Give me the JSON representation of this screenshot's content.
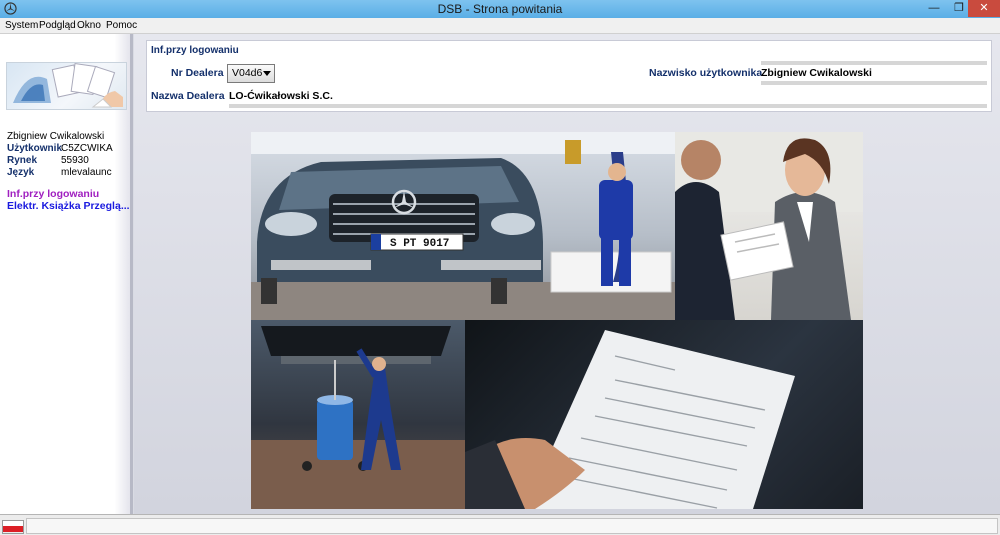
{
  "window": {
    "title": "DSB - Strona powitania",
    "min_glyph": "—",
    "max_glyph": "❐",
    "close_glyph": "✕"
  },
  "menu": {
    "items": [
      "System",
      "Podgląd",
      "Okno",
      "Pomoc"
    ]
  },
  "sidebar": {
    "user_name": "Zbigniew Cwikalowski",
    "rows": [
      {
        "label": "Użytkownik",
        "value": "C5ZCWIKA"
      },
      {
        "label": "Rynek",
        "value": "55930"
      },
      {
        "label": "Język",
        "value": "mlevalaunc"
      }
    ],
    "links": [
      {
        "label": "Inf.przy logowaniu",
        "color": "#a020c0"
      },
      {
        "label": "Elektr. Książka Przeglą...",
        "color": "#1a1adf"
      }
    ]
  },
  "login_info": {
    "title": "Inf.przy logowaniu",
    "dealer_no_label": "Nr Dealera",
    "dealer_no_value": "V04d6",
    "user_surname_label": "Nazwisko użytkownika",
    "user_surname_value": "Zbigniew  Cwikalowski",
    "dealer_name_label": "Nazwa Dealera",
    "dealer_name_value": "LO-Ćwikałowski S.C."
  },
  "collage": {
    "plate": "S PT 9017",
    "tiles": [
      "car-lift-photo",
      "consultation-photo",
      "undercar-service-photo",
      "document-photo"
    ]
  },
  "colors": {
    "label_blue": "#14306b",
    "titlebar": "#5aaee6",
    "flag_red": "#dc1f26"
  }
}
